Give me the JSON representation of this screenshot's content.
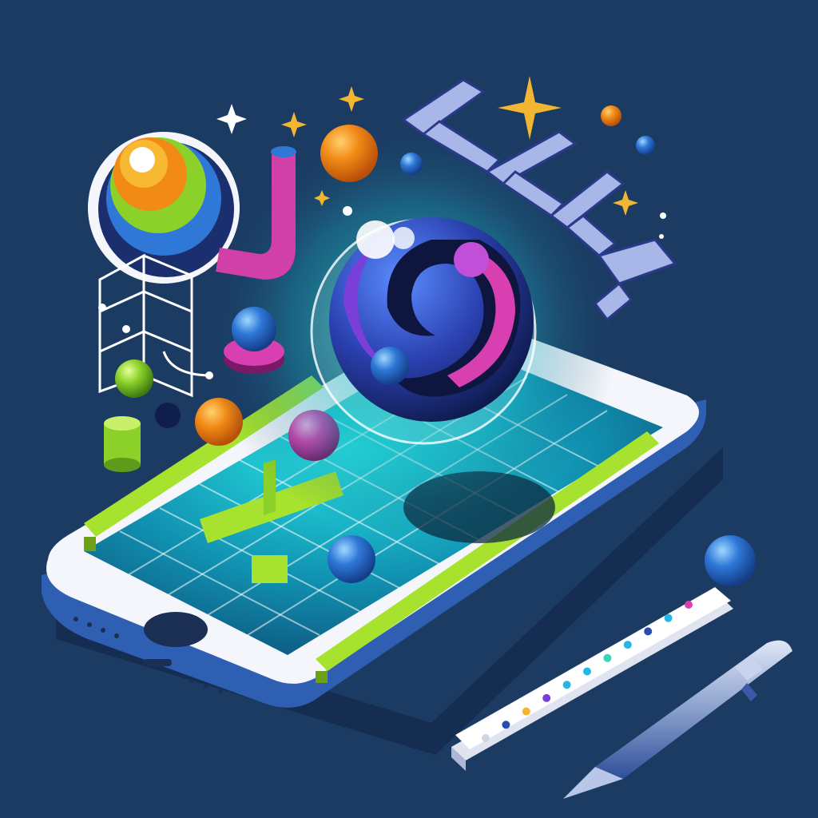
{
  "palette": {
    "background": "#1b3b63",
    "phone_body": "#f4f6fb",
    "phone_edge": "#2f5fb3",
    "screen": "#0f4f7a",
    "screen_glow": "#1fd0d8",
    "maze_wall": "#a6e22e",
    "orb_glow": "#2fe0c8",
    "orange": "#f28a16",
    "blue": "#2f78d8",
    "pink": "#d83fb0",
    "purple": "#7a3fd8",
    "lime": "#8bd12a",
    "sparkle": "#f2b632"
  },
  "ruler_dots": [
    "#cfd5e2",
    "#2a4cae",
    "#f2b632",
    "#7a3fd8",
    "#21b8e8",
    "#21b8e8",
    "#37d6b6",
    "#21b8e8",
    "#2a4cae",
    "#21b8e8",
    "#d83fb0"
  ],
  "icons": [
    "smartphone-icon",
    "maze-icon",
    "orb-icon",
    "ruler-icon",
    "stylus-pen-icon",
    "sparkle-icon"
  ]
}
